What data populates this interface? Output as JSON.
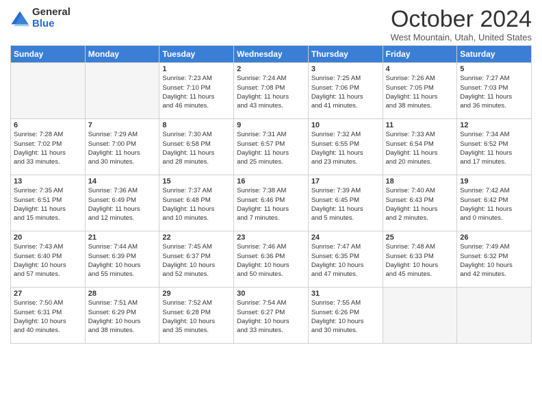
{
  "logo": {
    "general": "General",
    "blue": "Blue"
  },
  "header": {
    "month": "October 2024",
    "location": "West Mountain, Utah, United States"
  },
  "days": [
    "Sunday",
    "Monday",
    "Tuesday",
    "Wednesday",
    "Thursday",
    "Friday",
    "Saturday"
  ],
  "weeks": [
    [
      {
        "day": "",
        "empty": true
      },
      {
        "day": "",
        "empty": true
      },
      {
        "day": "1",
        "line1": "Sunrise: 7:23 AM",
        "line2": "Sunset: 7:10 PM",
        "line3": "Daylight: 11 hours",
        "line4": "and 46 minutes."
      },
      {
        "day": "2",
        "line1": "Sunrise: 7:24 AM",
        "line2": "Sunset: 7:08 PM",
        "line3": "Daylight: 11 hours",
        "line4": "and 43 minutes."
      },
      {
        "day": "3",
        "line1": "Sunrise: 7:25 AM",
        "line2": "Sunset: 7:06 PM",
        "line3": "Daylight: 11 hours",
        "line4": "and 41 minutes."
      },
      {
        "day": "4",
        "line1": "Sunrise: 7:26 AM",
        "line2": "Sunset: 7:05 PM",
        "line3": "Daylight: 11 hours",
        "line4": "and 38 minutes."
      },
      {
        "day": "5",
        "line1": "Sunrise: 7:27 AM",
        "line2": "Sunset: 7:03 PM",
        "line3": "Daylight: 11 hours",
        "line4": "and 36 minutes."
      }
    ],
    [
      {
        "day": "6",
        "line1": "Sunrise: 7:28 AM",
        "line2": "Sunset: 7:02 PM",
        "line3": "Daylight: 11 hours",
        "line4": "and 33 minutes."
      },
      {
        "day": "7",
        "line1": "Sunrise: 7:29 AM",
        "line2": "Sunset: 7:00 PM",
        "line3": "Daylight: 11 hours",
        "line4": "and 30 minutes."
      },
      {
        "day": "8",
        "line1": "Sunrise: 7:30 AM",
        "line2": "Sunset: 6:58 PM",
        "line3": "Daylight: 11 hours",
        "line4": "and 28 minutes."
      },
      {
        "day": "9",
        "line1": "Sunrise: 7:31 AM",
        "line2": "Sunset: 6:57 PM",
        "line3": "Daylight: 11 hours",
        "line4": "and 25 minutes."
      },
      {
        "day": "10",
        "line1": "Sunrise: 7:32 AM",
        "line2": "Sunset: 6:55 PM",
        "line3": "Daylight: 11 hours",
        "line4": "and 23 minutes."
      },
      {
        "day": "11",
        "line1": "Sunrise: 7:33 AM",
        "line2": "Sunset: 6:54 PM",
        "line3": "Daylight: 11 hours",
        "line4": "and 20 minutes."
      },
      {
        "day": "12",
        "line1": "Sunrise: 7:34 AM",
        "line2": "Sunset: 6:52 PM",
        "line3": "Daylight: 11 hours",
        "line4": "and 17 minutes."
      }
    ],
    [
      {
        "day": "13",
        "line1": "Sunrise: 7:35 AM",
        "line2": "Sunset: 6:51 PM",
        "line3": "Daylight: 11 hours",
        "line4": "and 15 minutes."
      },
      {
        "day": "14",
        "line1": "Sunrise: 7:36 AM",
        "line2": "Sunset: 6:49 PM",
        "line3": "Daylight: 11 hours",
        "line4": "and 12 minutes."
      },
      {
        "day": "15",
        "line1": "Sunrise: 7:37 AM",
        "line2": "Sunset: 6:48 PM",
        "line3": "Daylight: 11 hours",
        "line4": "and 10 minutes."
      },
      {
        "day": "16",
        "line1": "Sunrise: 7:38 AM",
        "line2": "Sunset: 6:46 PM",
        "line3": "Daylight: 11 hours",
        "line4": "and 7 minutes."
      },
      {
        "day": "17",
        "line1": "Sunrise: 7:39 AM",
        "line2": "Sunset: 6:45 PM",
        "line3": "Daylight: 11 hours",
        "line4": "and 5 minutes."
      },
      {
        "day": "18",
        "line1": "Sunrise: 7:40 AM",
        "line2": "Sunset: 6:43 PM",
        "line3": "Daylight: 11 hours",
        "line4": "and 2 minutes."
      },
      {
        "day": "19",
        "line1": "Sunrise: 7:42 AM",
        "line2": "Sunset: 6:42 PM",
        "line3": "Daylight: 11 hours",
        "line4": "and 0 minutes."
      }
    ],
    [
      {
        "day": "20",
        "line1": "Sunrise: 7:43 AM",
        "line2": "Sunset: 6:40 PM",
        "line3": "Daylight: 10 hours",
        "line4": "and 57 minutes."
      },
      {
        "day": "21",
        "line1": "Sunrise: 7:44 AM",
        "line2": "Sunset: 6:39 PM",
        "line3": "Daylight: 10 hours",
        "line4": "and 55 minutes."
      },
      {
        "day": "22",
        "line1": "Sunrise: 7:45 AM",
        "line2": "Sunset: 6:37 PM",
        "line3": "Daylight: 10 hours",
        "line4": "and 52 minutes."
      },
      {
        "day": "23",
        "line1": "Sunrise: 7:46 AM",
        "line2": "Sunset: 6:36 PM",
        "line3": "Daylight: 10 hours",
        "line4": "and 50 minutes."
      },
      {
        "day": "24",
        "line1": "Sunrise: 7:47 AM",
        "line2": "Sunset: 6:35 PM",
        "line3": "Daylight: 10 hours",
        "line4": "and 47 minutes."
      },
      {
        "day": "25",
        "line1": "Sunrise: 7:48 AM",
        "line2": "Sunset: 6:33 PM",
        "line3": "Daylight: 10 hours",
        "line4": "and 45 minutes."
      },
      {
        "day": "26",
        "line1": "Sunrise: 7:49 AM",
        "line2": "Sunset: 6:32 PM",
        "line3": "Daylight: 10 hours",
        "line4": "and 42 minutes."
      }
    ],
    [
      {
        "day": "27",
        "line1": "Sunrise: 7:50 AM",
        "line2": "Sunset: 6:31 PM",
        "line3": "Daylight: 10 hours",
        "line4": "and 40 minutes."
      },
      {
        "day": "28",
        "line1": "Sunrise: 7:51 AM",
        "line2": "Sunset: 6:29 PM",
        "line3": "Daylight: 10 hours",
        "line4": "and 38 minutes."
      },
      {
        "day": "29",
        "line1": "Sunrise: 7:52 AM",
        "line2": "Sunset: 6:28 PM",
        "line3": "Daylight: 10 hours",
        "line4": "and 35 minutes."
      },
      {
        "day": "30",
        "line1": "Sunrise: 7:54 AM",
        "line2": "Sunset: 6:27 PM",
        "line3": "Daylight: 10 hours",
        "line4": "and 33 minutes."
      },
      {
        "day": "31",
        "line1": "Sunrise: 7:55 AM",
        "line2": "Sunset: 6:26 PM",
        "line3": "Daylight: 10 hours",
        "line4": "and 30 minutes."
      },
      {
        "day": "",
        "empty": true
      },
      {
        "day": "",
        "empty": true
      }
    ]
  ]
}
